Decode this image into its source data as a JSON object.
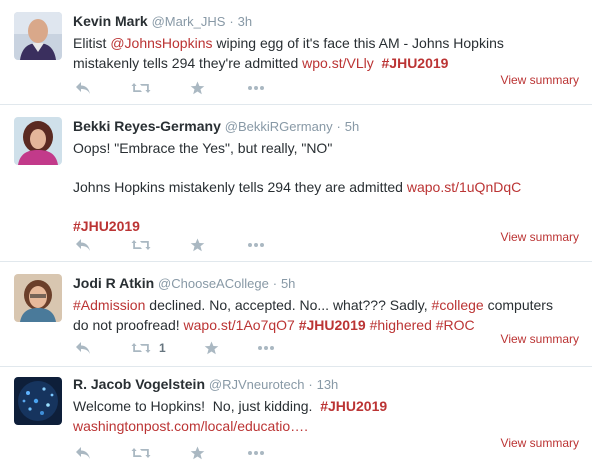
{
  "tweets": [
    {
      "name": "Kevin Mark",
      "handle": "@Mark_JHS",
      "dot": "·",
      "time": "3h",
      "lines": [
        [
          {
            "t": "text",
            "v": "Elitist "
          },
          {
            "t": "link",
            "v": "@JohnsHopkins"
          },
          {
            "t": "text",
            "v": " wiping egg of it's face this AM - Johns Hopkins"
          }
        ],
        [
          {
            "t": "text",
            "v": "mistakenly tells 294 they're admitted "
          },
          {
            "t": "link",
            "v": "wpo.st/VLly"
          },
          {
            "t": "text",
            "v": "  "
          },
          {
            "t": "hash",
            "v": "JHU2019"
          }
        ]
      ],
      "retweet_count": "",
      "summary": "View summary"
    },
    {
      "name": "Bekki Reyes-Germany",
      "handle": "@BekkiRGermany",
      "dot": "·",
      "time": "5h",
      "lines": [
        [
          {
            "t": "text",
            "v": "Oops! \"Embrace the Yes\", but really, \"NO\""
          }
        ],
        [],
        [
          {
            "t": "text",
            "v": "Johns Hopkins mistakenly tells 294 they are admitted "
          },
          {
            "t": "link",
            "v": "wapo.st/1uQnDqC"
          }
        ],
        [],
        [
          {
            "t": "hash",
            "v": "JHU2019"
          }
        ]
      ],
      "retweet_count": "",
      "summary": "View summary"
    },
    {
      "name": "Jodi R Atkin",
      "handle": "@ChooseACollege",
      "dot": "·",
      "time": "5h",
      "lines": [
        [
          {
            "t": "hashn",
            "v": "Admission"
          },
          {
            "t": "text",
            "v": " declined. No, accepted. No... what??? Sadly, "
          },
          {
            "t": "hashn",
            "v": "college"
          },
          {
            "t": "text",
            "v": " computers"
          }
        ],
        [
          {
            "t": "text",
            "v": "do not proofread! "
          },
          {
            "t": "link",
            "v": "wapo.st/1Ao7qO7"
          },
          {
            "t": "text",
            "v": " "
          },
          {
            "t": "hash",
            "v": "JHU2019"
          },
          {
            "t": "text",
            "v": " "
          },
          {
            "t": "hashn",
            "v": "highered"
          },
          {
            "t": "text",
            "v": " "
          },
          {
            "t": "hashn",
            "v": "ROC"
          }
        ]
      ],
      "retweet_count": "1",
      "summary": "View summary"
    },
    {
      "name": "R. Jacob Vogelstein",
      "handle": "@RJVneurotech",
      "dot": "·",
      "time": "13h",
      "lines": [
        [
          {
            "t": "text",
            "v": "Welcome to Hopkins!  No, just kidding.  "
          },
          {
            "t": "hash",
            "v": "JHU2019"
          }
        ],
        [
          {
            "t": "link",
            "v": "washingtonpost.com/local/educatio…."
          }
        ]
      ],
      "retweet_count": "",
      "summary": "View summary"
    }
  ],
  "icons": {
    "reply": "reply-icon",
    "retweet": "retweet-icon",
    "favorite": "star-icon",
    "more": "more-dots-icon"
  },
  "colors": {
    "link": "#bb3434",
    "meta": "#8899a6",
    "action": "#aab8c2",
    "border": "#e1e8ed"
  }
}
